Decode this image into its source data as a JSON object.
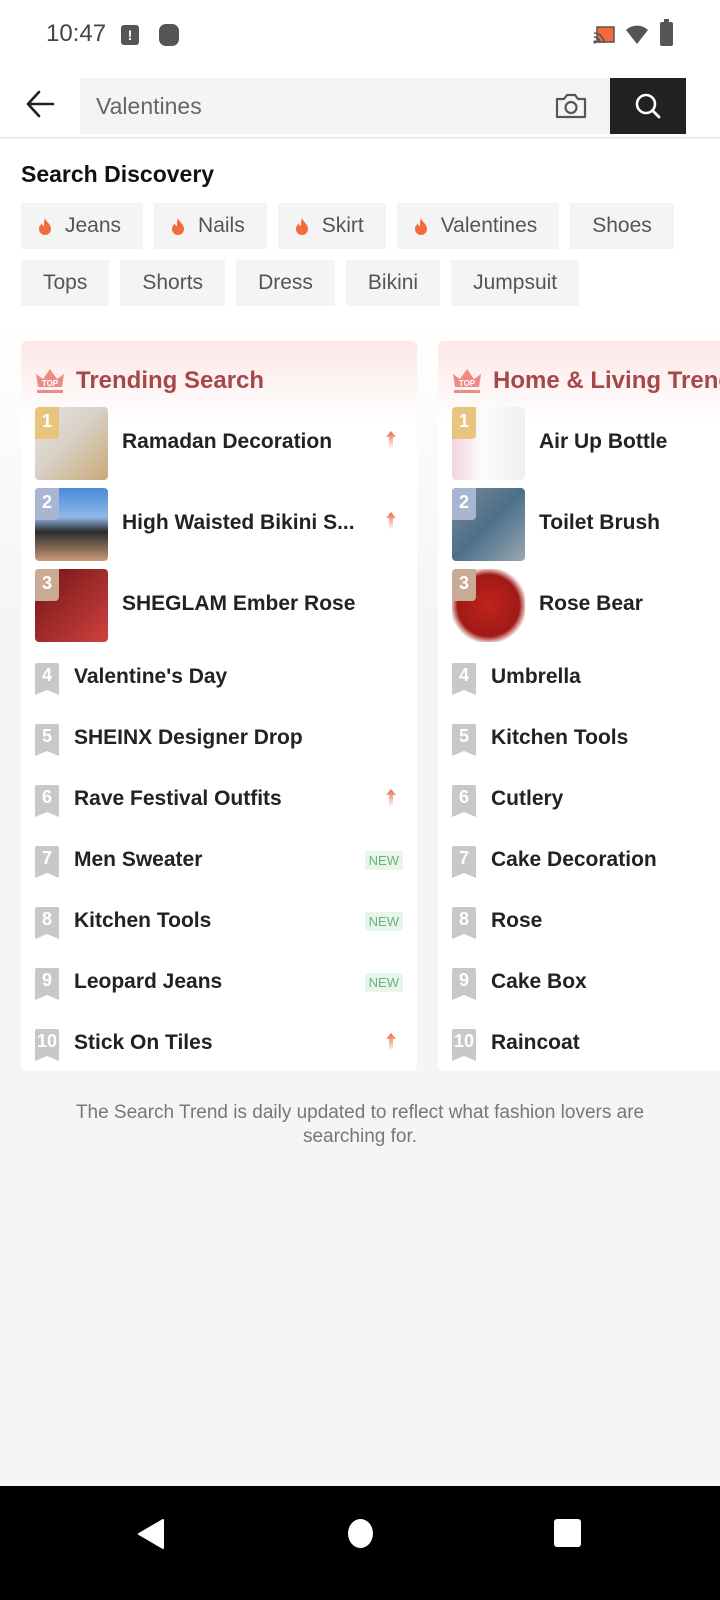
{
  "status_bar": {
    "time": "10:47",
    "alert_icon_glyph": "!",
    "icons": [
      "alert-icon",
      "app-dot-icon",
      "cast-icon",
      "wifi-icon",
      "battery-icon"
    ]
  },
  "search": {
    "value": "Valentines",
    "placeholder": "Valentines",
    "back_icon": "arrow-left-icon",
    "camera_icon": "camera-icon",
    "search_icon": "search-icon"
  },
  "discovery": {
    "title": "Search Discovery",
    "rows": [
      [
        {
          "label": "Jeans",
          "hot": true
        },
        {
          "label": "Nails",
          "hot": true
        },
        {
          "label": "Skirt",
          "hot": true
        },
        {
          "label": "Valentines",
          "hot": true
        },
        {
          "label": "Shoes",
          "hot": false
        }
      ],
      [
        {
          "label": "Tops",
          "hot": false
        },
        {
          "label": "Shorts",
          "hot": false
        },
        {
          "label": "Dress",
          "hot": false
        },
        {
          "label": "Bikini",
          "hot": false
        },
        {
          "label": "Jumpsuit",
          "hot": false
        }
      ]
    ]
  },
  "colors": {
    "flame": "#f26a3d",
    "title_red": "#a74848",
    "rank1": "#e8c47f",
    "rank2": "#a9b6d3",
    "rank3": "#c9aa93",
    "rank_other": "#c8c8c8",
    "trend_up": "#ea6a43",
    "new_bg": "#e6f6ea",
    "new_text": "#6db07c"
  },
  "trending": {
    "title": "Trending Search",
    "items": [
      {
        "rank": "1",
        "label": "Ramadan Decoration",
        "indicator": "up"
      },
      {
        "rank": "2",
        "label": "High Waisted Bikini S...",
        "indicator": "up"
      },
      {
        "rank": "3",
        "label": "SHEGLAM Ember Rose",
        "indicator": ""
      },
      {
        "rank": "4",
        "label": "Valentine's Day",
        "indicator": ""
      },
      {
        "rank": "5",
        "label": "SHEINX Designer Drop",
        "indicator": ""
      },
      {
        "rank": "6",
        "label": "Rave Festival Outfits",
        "indicator": "up"
      },
      {
        "rank": "7",
        "label": "Men Sweater",
        "indicator": "NEW"
      },
      {
        "rank": "8",
        "label": "Kitchen Tools",
        "indicator": "NEW"
      },
      {
        "rank": "9",
        "label": "Leopard Jeans",
        "indicator": "NEW"
      },
      {
        "rank": "10",
        "label": "Stick On Tiles",
        "indicator": "up"
      }
    ]
  },
  "home_living": {
    "title": "Home & Living Trending",
    "items": [
      {
        "rank": "1",
        "label": "Air Up Bottle",
        "indicator": ""
      },
      {
        "rank": "2",
        "label": "Toilet Brush",
        "indicator": ""
      },
      {
        "rank": "3",
        "label": "Rose Bear",
        "indicator": ""
      },
      {
        "rank": "4",
        "label": "Umbrella",
        "indicator": ""
      },
      {
        "rank": "5",
        "label": "Kitchen Tools",
        "indicator": ""
      },
      {
        "rank": "6",
        "label": "Cutlery",
        "indicator": ""
      },
      {
        "rank": "7",
        "label": "Cake Decoration",
        "indicator": ""
      },
      {
        "rank": "8",
        "label": "Rose",
        "indicator": ""
      },
      {
        "rank": "9",
        "label": "Cake Box",
        "indicator": ""
      },
      {
        "rank": "10",
        "label": "Raincoat",
        "indicator": ""
      }
    ]
  },
  "footer_note": "The Search Trend is daily updated to reflect what fashion lovers are searching for.",
  "nav": {
    "back": "nav-back-icon",
    "home": "nav-home-icon",
    "recents": "nav-recents-icon"
  }
}
